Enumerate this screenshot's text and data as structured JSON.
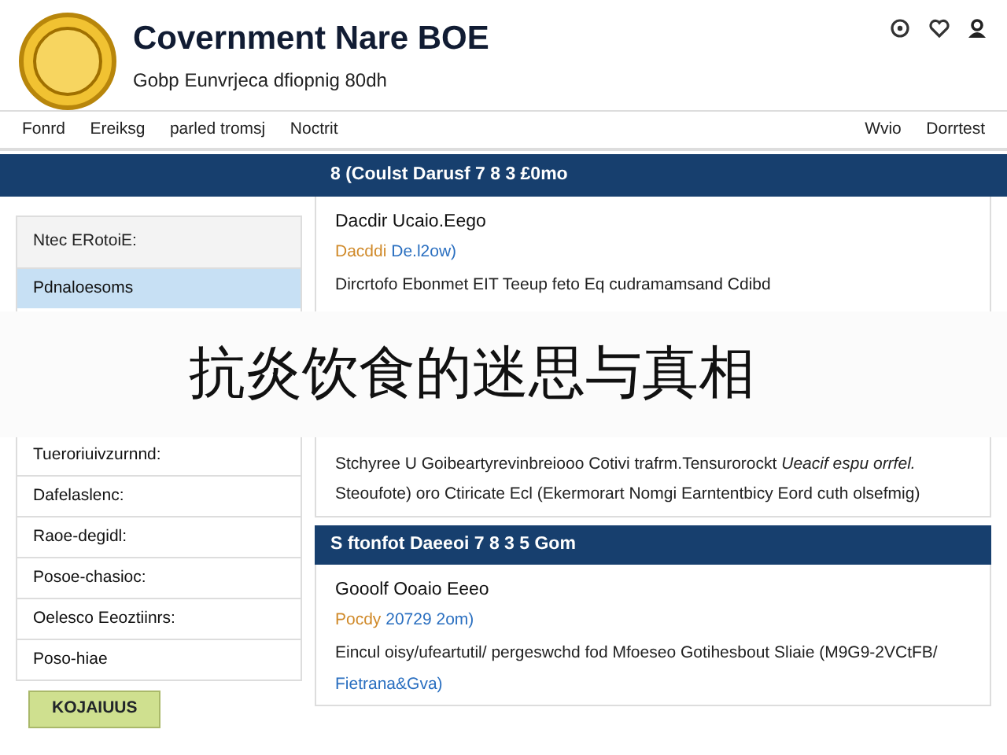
{
  "header": {
    "title": "Covernment Nare BOE",
    "subtitle": "Gobp Eunvrjeca dfiopnig 80dh"
  },
  "nav": {
    "left": [
      "Fonrd",
      "Ereiksg",
      "parled tromsj",
      "Noctrit"
    ],
    "right": [
      "Wvio",
      "Dorrtest"
    ]
  },
  "banner": "8 (Coulst Darusf 7 8 3 £0mo",
  "sidebar": {
    "title": "Ntec ERotoiE:",
    "items_above": [
      {
        "label": "Pdnaloesoms",
        "selected": true
      }
    ],
    "items_below": [
      {
        "label": "Tueroriuivzurnnd:",
        "selected": false
      },
      {
        "label": "Dafelaslenc:",
        "selected": false
      },
      {
        "label": "Raoe-degidl:",
        "selected": false
      },
      {
        "label": "Posoe-chasioc:",
        "selected": false
      },
      {
        "label": "Oelesco Eeoztiinrs:",
        "selected": false
      },
      {
        "label": "Poso-hiae",
        "selected": false
      }
    ],
    "button": "KOJAIUUS"
  },
  "sections": [
    {
      "heading": "Dacdir Ucaio.Eego",
      "meta_a": "Dacddi",
      "meta_b": "De.l2ow)",
      "paragraphs_above": [
        {
          "kind": "text",
          "text": "Dircrtofo Ebonmet EIT Teeup feto Eq cudramamsand Cdibd"
        }
      ],
      "paragraphs_below": [
        {
          "kind": "text",
          "text": "Stchyree U Goibeartyrevinbreiooo Cotivi trafrm.Tensurorockt *Ueacif espu orrfel.*"
        },
        {
          "kind": "text",
          "text": "Steoufote) oro Ctiricate Ecl (Ekermorart Nomgi Earntentbicy Eord cuth olsefmig)"
        }
      ]
    },
    {
      "bar": "S ftonfot Daeeoi 7 8 3 5 Gom",
      "heading": "Gooolf Ooaio Eeeo",
      "meta_a": "Pocdy",
      "meta_b": "20729 2om)",
      "paragraphs_above": [
        {
          "kind": "text",
          "text": "Eincul oisy/ufeartutil/ pergeswchd fod Mfoeseo Gotihesbout Sliaie (M9G9-2VCtFB/"
        },
        {
          "kind": "link",
          "text": "Fietrana&Gva)"
        }
      ]
    }
  ],
  "overlay_title": "抗炎饮食的迷思与真相"
}
